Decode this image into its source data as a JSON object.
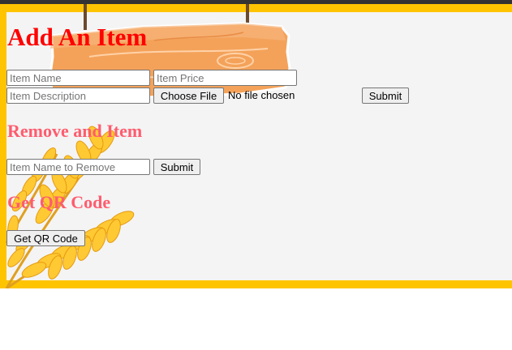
{
  "add_section": {
    "title": "Add An Item",
    "item_name_placeholder": "Item Name",
    "item_price_placeholder": "Item Price",
    "item_description_placeholder": "Item Description",
    "choose_file_label": "Choose File",
    "no_file_label": "No file chosen",
    "submit_label": "Submit"
  },
  "remove_section": {
    "title": "Remove and Item",
    "item_name_placeholder": "Item Name to Remove",
    "submit_label": "Submit"
  },
  "qr_section": {
    "title": "Get QR Code",
    "button_label": "Get QR Code"
  },
  "icons": [
    "wooden-sign-icon",
    "wheat-icon"
  ],
  "colors": {
    "frame": "#ffc400",
    "panel": "#f4f4f4",
    "title": "#ff0000",
    "section_heading": "#ff5c6e",
    "top_bar": "#333333"
  }
}
